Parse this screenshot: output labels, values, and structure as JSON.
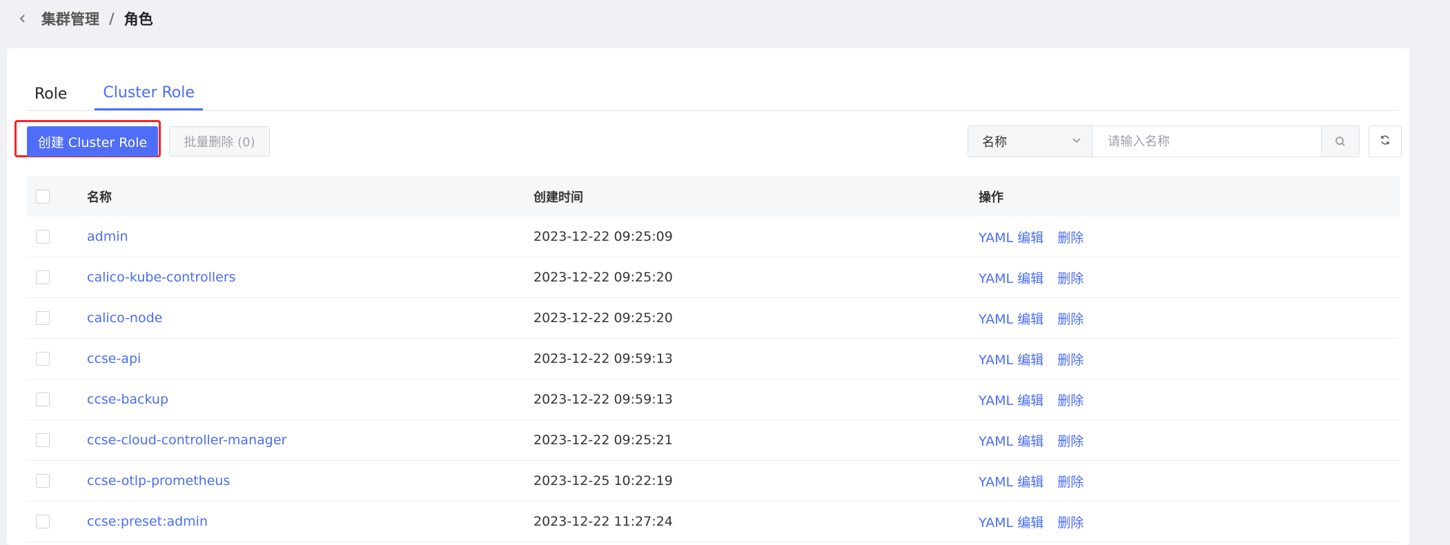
{
  "breadcrumb": {
    "parent": "集群管理",
    "separator": "/",
    "current": "角色"
  },
  "tabs": [
    {
      "label": "Role",
      "active": false
    },
    {
      "label": "Cluster Role",
      "active": true
    }
  ],
  "toolbar": {
    "create_label": "创建 Cluster Role",
    "batch_delete_label": "批量删除 (0)"
  },
  "search": {
    "field_selected": "名称",
    "placeholder": "请输入名称"
  },
  "table": {
    "columns": [
      "名称",
      "创建时间",
      "操作"
    ],
    "actions": {
      "yaml": "YAML",
      "edit": "编辑",
      "delete": "删除"
    },
    "rows": [
      {
        "name": "admin",
        "created": "2023-12-22 09:25:09"
      },
      {
        "name": "calico-kube-controllers",
        "created": "2023-12-22 09:25:20"
      },
      {
        "name": "calico-node",
        "created": "2023-12-22 09:25:20"
      },
      {
        "name": "ccse-api",
        "created": "2023-12-22 09:59:13"
      },
      {
        "name": "ccse-backup",
        "created": "2023-12-22 09:59:13"
      },
      {
        "name": "ccse-cloud-controller-manager",
        "created": "2023-12-22 09:25:21"
      },
      {
        "name": "ccse-otlp-prometheus",
        "created": "2023-12-25 10:22:19"
      },
      {
        "name": "ccse:preset:admin",
        "created": "2023-12-22 11:27:24"
      }
    ]
  },
  "colors": {
    "accent": "#4a6cf7",
    "primary_button": "#4f6ef7",
    "highlight": "#ff1f1f",
    "page_bg": "#f0f1f5"
  },
  "icons": {
    "back": "chevron-left-icon",
    "dropdown": "chevron-down-icon",
    "search": "search-icon",
    "refresh": "refresh-icon"
  }
}
